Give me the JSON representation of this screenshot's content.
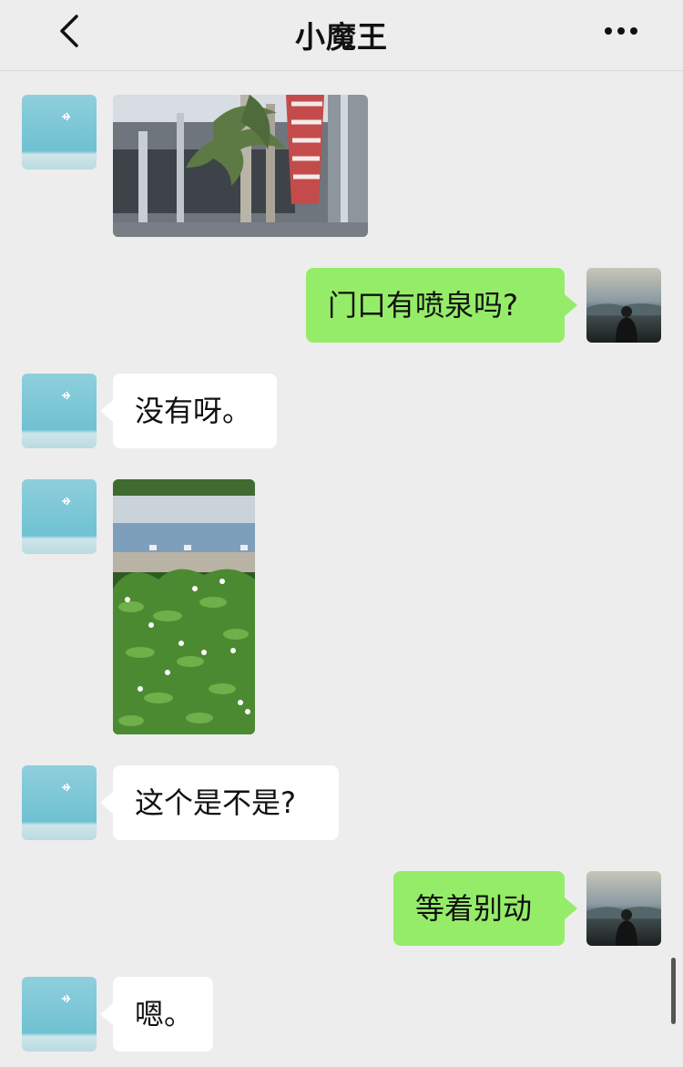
{
  "header": {
    "back_icon": "chevron-left-icon",
    "title": "小魔王",
    "more_icon": "more-dots-icon"
  },
  "messages": [
    {
      "side": "in",
      "kind": "image",
      "content": "photo of tall building with palm trees and striped flag"
    },
    {
      "side": "out",
      "kind": "text",
      "text": "门口有喷泉吗?"
    },
    {
      "side": "in",
      "kind": "text",
      "text": "没有呀。"
    },
    {
      "side": "in",
      "kind": "image",
      "content": "photo of green shrubs with white flowers beside a pool"
    },
    {
      "side": "in",
      "kind": "text",
      "text": "这个是不是?"
    },
    {
      "side": "out",
      "kind": "text",
      "text": "等着别动"
    },
    {
      "side": "in",
      "kind": "text",
      "text": "嗯。"
    }
  ],
  "colors": {
    "background": "#ededed",
    "incoming_bubble": "#ffffff",
    "outgoing_bubble": "#95ec69"
  }
}
